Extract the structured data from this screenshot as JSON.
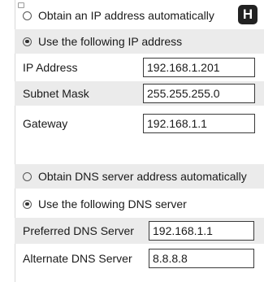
{
  "ip": {
    "obtain_auto_label": "Obtain an IP address automatically",
    "use_following_label": "Use the following IP address",
    "fields": [
      {
        "label": "IP Address",
        "value": "192.168.1.201"
      },
      {
        "label": "Subnet Mask",
        "value": "255.255.255.0"
      },
      {
        "label": "Gateway",
        "value": "192.168.1.1"
      }
    ]
  },
  "dns": {
    "obtain_auto_label": "Obtain DNS server address automatically",
    "use_following_label": "Use the following DNS server",
    "fields": [
      {
        "label": "Preferred DNS Server",
        "value": "192.168.1.1"
      },
      {
        "label": "Alternate DNS Server",
        "value": "8.8.8.8"
      }
    ]
  },
  "badge": "H"
}
